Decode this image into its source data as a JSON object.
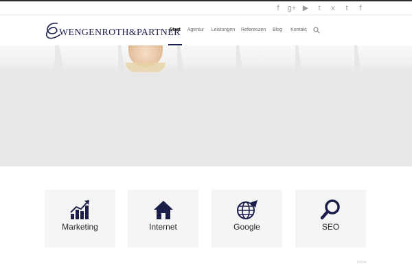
{
  "social": [
    "facebook-icon",
    "google-plus-icon",
    "youtube-icon",
    "twitter-icon",
    "xing-icon",
    "tumblr-icon",
    "facebook-icon"
  ],
  "social_glyphs": [
    "f",
    "g+",
    "▶",
    "t",
    "x",
    "t",
    "f"
  ],
  "logo": {
    "text": "WENGENROTH&PARTNER"
  },
  "nav": {
    "items": [
      "Start",
      "Agentur",
      "Leistungen",
      "Referenzen",
      "Blog",
      "Kontakt"
    ],
    "active": "Start"
  },
  "features": [
    {
      "label": "Marketing",
      "icon": "chart-growth-icon"
    },
    {
      "label": "Internet",
      "icon": "home-icon"
    },
    {
      "label": "Google",
      "icon": "globe-arrow-icon"
    },
    {
      "label": "SEO",
      "icon": "magnifier-icon"
    }
  ],
  "footer": {
    "more": "more"
  },
  "colors": {
    "brand": "#1b1e4a",
    "nav": "#666666",
    "hero_bg": "#e7e7e7",
    "card_bg": "#f5f5f5"
  }
}
